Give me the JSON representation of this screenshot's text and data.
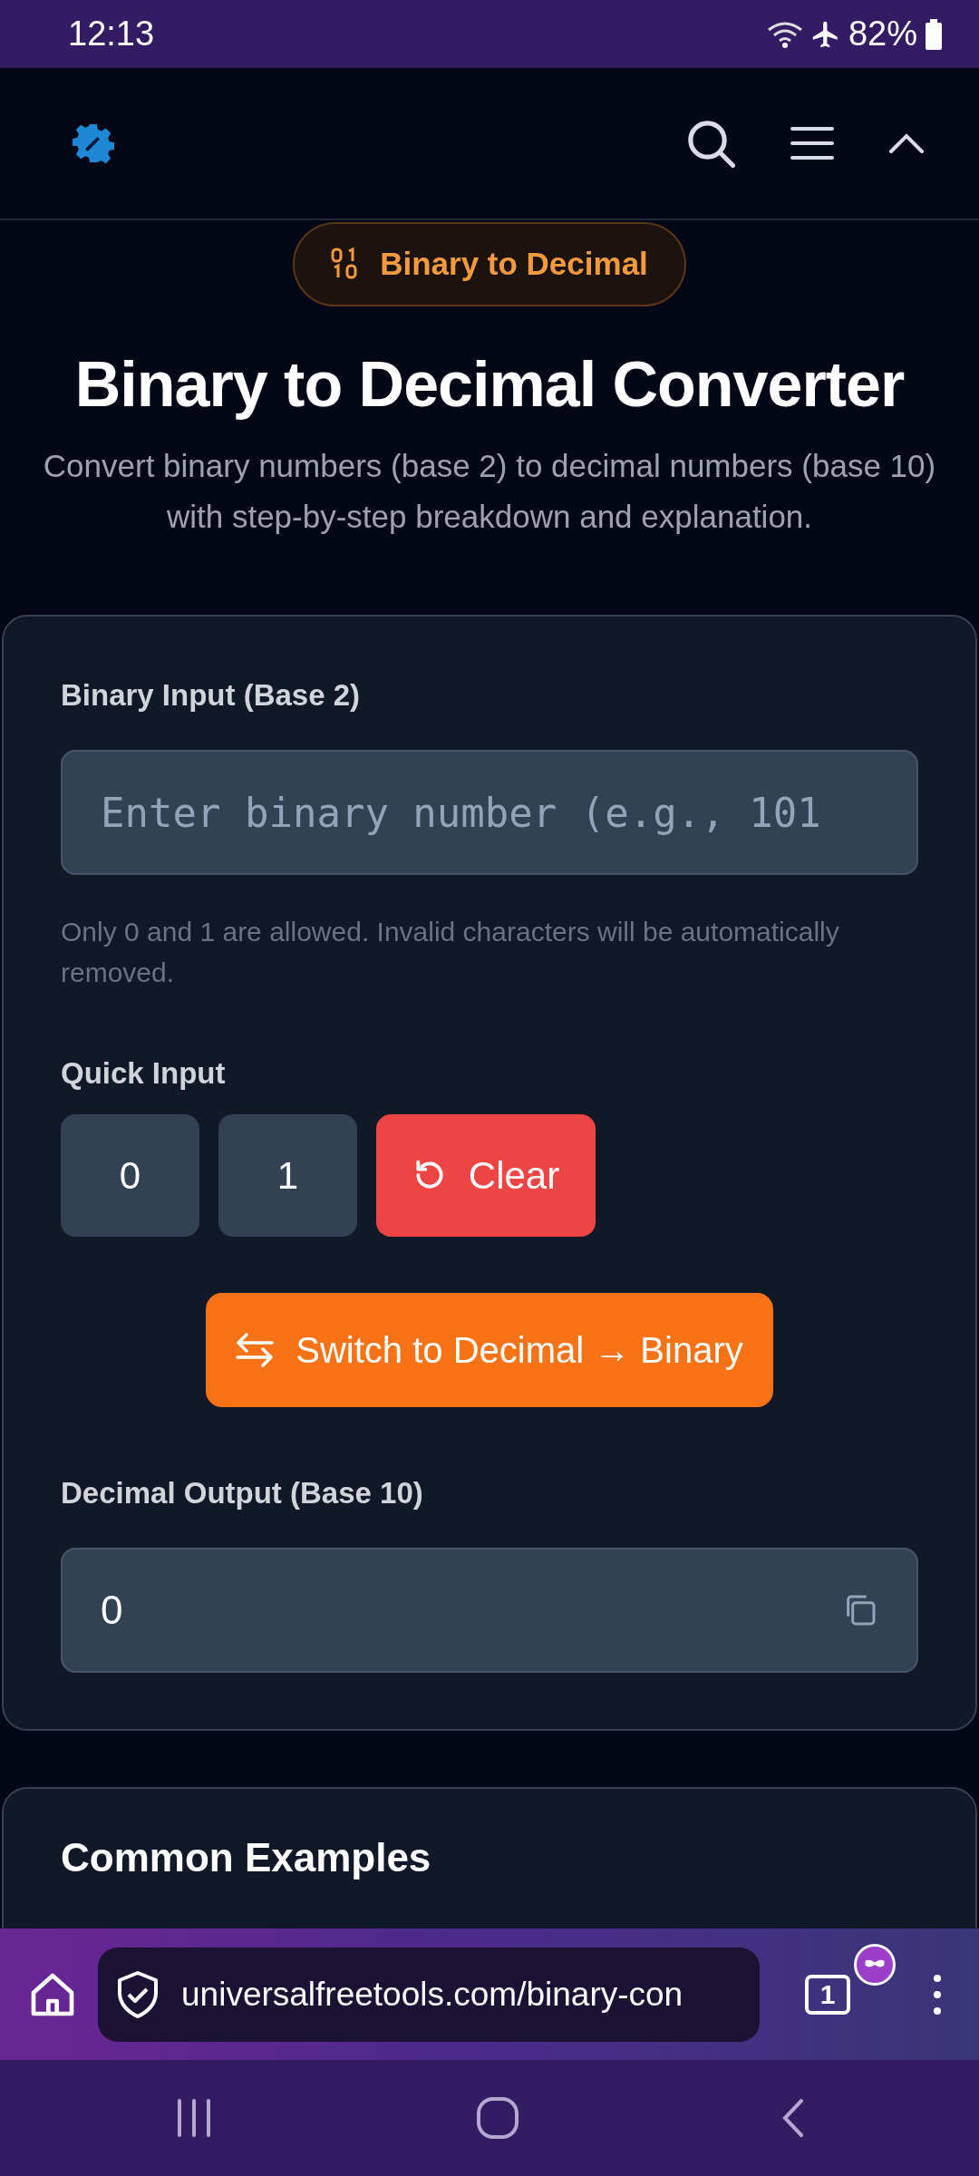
{
  "status_bar": {
    "time": "12:13",
    "battery": "82%"
  },
  "badge": {
    "label": "Binary to Decimal"
  },
  "title": "Binary to Decimal Converter",
  "subtitle": "Convert binary numbers (base 2) to decimal numbers (base 10) with step-by-step breakdown and explanation.",
  "converter": {
    "input_label": "Binary Input (Base 2)",
    "input": {
      "placeholder": "Enter binary number (e.g., 101"
    },
    "help": "Only 0 and 1 are allowed. Invalid characters will be automatically removed.",
    "quick_label": "Quick Input",
    "quick_buttons": [
      {
        "kind": "digit",
        "label": "0"
      },
      {
        "kind": "digit",
        "label": "1"
      },
      {
        "kind": "clear",
        "label": "Clear"
      }
    ],
    "switch_button": "Switch to Decimal → Binary",
    "output_label": "Decimal Output (Base 10)",
    "output": {
      "value": "0"
    }
  },
  "examples": {
    "title": "Common Examples"
  },
  "browser": {
    "url": "universalfreetools.com/binary-con",
    "tab_count": "1"
  }
}
